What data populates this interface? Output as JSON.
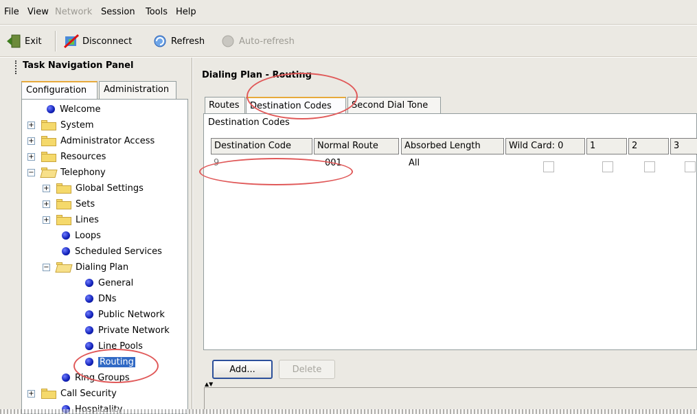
{
  "menu": {
    "file": "File",
    "view": "View",
    "network": "Network",
    "session": "Session",
    "tools": "Tools",
    "help": "Help"
  },
  "toolbar": {
    "exit": "Exit",
    "disconnect": "Disconnect",
    "refresh": "Refresh",
    "auto_refresh": "Auto-refresh"
  },
  "nav": {
    "title": "Task Navigation Panel",
    "tabs": [
      "Configuration",
      "Administration"
    ],
    "tree": {
      "welcome": "Welcome",
      "system": "System",
      "admin_access": "Administrator Access",
      "resources": "Resources",
      "telephony": "Telephony",
      "global_settings": "Global Settings",
      "sets": "Sets",
      "lines": "Lines",
      "loops": "Loops",
      "scheduled_services": "Scheduled Services",
      "dialing_plan": "Dialing Plan",
      "general": "General",
      "dns": "DNs",
      "public_network": "Public Network",
      "private_network": "Private Network",
      "line_pools": "Line Pools",
      "routing": "Routing",
      "ring_groups": "Ring Groups",
      "call_security": "Call Security",
      "hospitality": "Hospitality"
    }
  },
  "main": {
    "title": "Dialing Plan - Routing",
    "tabs": [
      "Routes",
      "Destination Codes",
      "Second Dial Tone"
    ],
    "pane_label": "Destination Codes",
    "columns": [
      "Destination Code",
      "Normal Route",
      "Absorbed Length",
      "Wild Card: 0",
      "1",
      "2",
      "3"
    ],
    "row": {
      "destination_code": "9",
      "normal_route": "001",
      "absorbed_length": "All"
    },
    "add_button": "Add...",
    "delete_button": "Delete"
  },
  "colors": {
    "chrome": "#ebe9e3",
    "selection": "#316ac5",
    "callout": "#e05858",
    "tab_highlight": "#e7a93a"
  }
}
